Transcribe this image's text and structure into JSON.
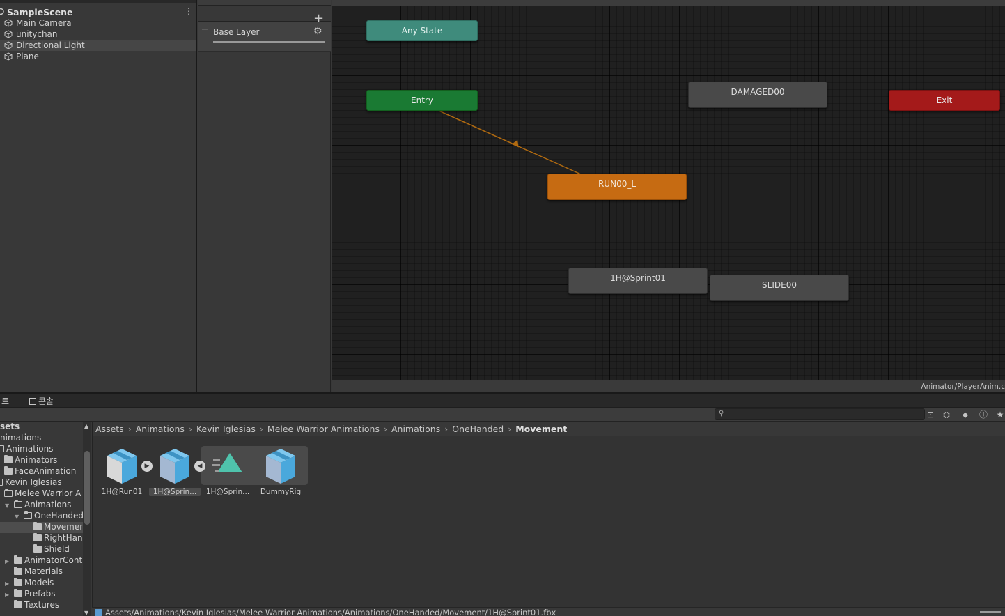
{
  "hierarchy": {
    "scene_name": "SampleScene",
    "items": [
      {
        "label": "Main Camera"
      },
      {
        "label": "unitychan"
      },
      {
        "label": "Directional Light"
      },
      {
        "label": "Plane"
      }
    ]
  },
  "layers": {
    "layer_name": "Base Layer"
  },
  "graph": {
    "states": {
      "any_state": "Any State",
      "entry": "Entry",
      "exit": "Exit",
      "damaged": "DAMAGED00",
      "run": "RUN00_L",
      "sprint": "1H@Sprint01",
      "slide": "SLIDE00"
    },
    "footer_path": "Animator/PlayerAnim.c",
    "colors": {
      "any_state": "#3f8b7c",
      "entry": "#1a7a33",
      "exit": "#a41a1a",
      "default_state": "#c66b12",
      "state": "#494949",
      "transition": "#b06a10"
    }
  },
  "project": {
    "tabs": [
      "트",
      "콘솔"
    ],
    "breadcrumb": [
      "Assets",
      "Animations",
      "Kevin Iglesias",
      "Melee Warrior Animations",
      "Animations",
      "OneHanded",
      "Movement"
    ],
    "tree": [
      "sets",
      "nimations",
      "Animations",
      "Animators",
      "FaceAnimation",
      "Kevin Iglesias",
      "Melee Warrior A",
      "Animations",
      "OneHanded",
      "Movemer",
      "RightHan",
      "Shield",
      "AnimatorCont",
      "Materials",
      "Models",
      "Prefabs",
      "Textures"
    ],
    "assets": [
      {
        "label": "1H@Run01",
        "icon": "model-cube-icon"
      },
      {
        "label": "1H@Sprin...",
        "icon": "model-cube-icon"
      },
      {
        "label": "1H@Sprin...",
        "icon": "animation-clip-icon"
      },
      {
        "label": "DummyRig",
        "icon": "model-cube-icon"
      }
    ],
    "status_path": "Assets/Animations/Kevin Iglesias/Melee Warrior Animations/Animations/OneHanded/Movement/1H@Sprint01.fbx"
  }
}
